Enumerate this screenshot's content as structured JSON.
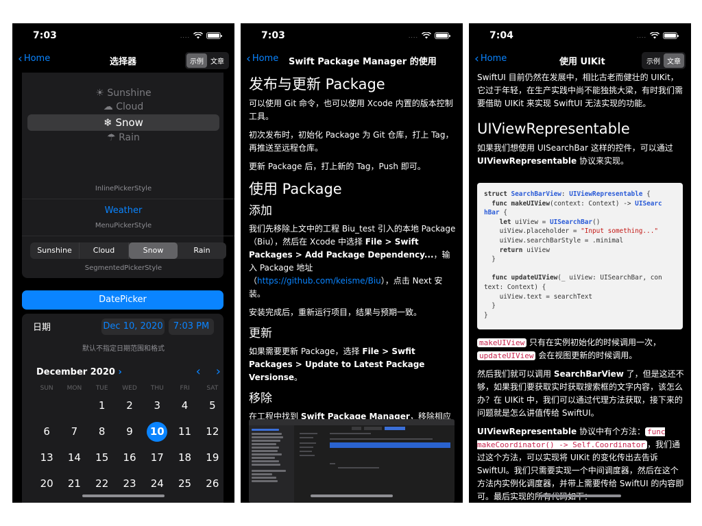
{
  "screens": {
    "picker": {
      "time": "7:03",
      "back_label": "Home",
      "title": "选择器",
      "seg": [
        "示例",
        "文章"
      ],
      "wheel": [
        "Sunshine",
        "Cloud",
        "Snow",
        "Rain"
      ],
      "inline_caption": "InlinePickerStyle",
      "menu_value": "Weather",
      "menu_caption": "MenuPickerStyle",
      "segmented": [
        "Sunshine",
        "Cloud",
        "Snow",
        "Rain"
      ],
      "segmented_selected": "Snow",
      "segmented_caption": "SegmentedPickerStyle",
      "datepicker_button": "DatePicker",
      "date_label": "日期",
      "date_value": "Dec 10, 2020",
      "time_value": "7:03 PM",
      "default_note": "默认不指定日期范围和格式",
      "month": "December 2020",
      "weekdays": [
        "SUN",
        "MON",
        "TUE",
        "WED",
        "THU",
        "FRI",
        "SAT"
      ],
      "days": [
        "",
        "",
        "1",
        "2",
        "3",
        "4",
        "5",
        "6",
        "7",
        "8",
        "9",
        "10",
        "11",
        "12",
        "13",
        "14",
        "15",
        "16",
        "17",
        "18",
        "19",
        "20",
        "21",
        "22",
        "23",
        "24",
        "25",
        "26"
      ],
      "today": "10"
    },
    "spm": {
      "time": "7:03",
      "back_label": "Home",
      "title": "Swift Package Manager 的使用",
      "h_publish": "发布与更新 Package",
      "p1": "可以使用 Git 命令，也可以使用 Xcode 内置的版本控制工具。",
      "p2": "初次发布时，初始化 Package 为 Git 仓库，打上 Tag，再推送至远程仓库。",
      "p3": "更新 Package 后，打上新的 Tag，Push 即可。",
      "h_use": "使用 Package",
      "h_add": "添加",
      "p4_a": "我们先移除上文中的工程 Biu_test 引入的本地 Package（Biu），然后在 Xcode 中选择 ",
      "p4_b": "File > Swift Packages > Add Package Dependency...",
      "p4_c": "，输入 Package 地址（",
      "p4_link": "https://github.com/keisme/Biu",
      "p4_d": "），点击 Next 安装。",
      "p5": "安装完成后，重新运行项目，结果与预期一致。",
      "h_update": "更新",
      "p6_a": "如果需要更新 Package，选择 ",
      "p6_b": "File > Swfit Packages > Update to Latest Package Versionse",
      "p6_c": "。",
      "h_remove": "移除",
      "p7_a": "在工程中找到 ",
      "p7_b": "Swift Package Manager",
      "p7_c": "，移除相应的 Package。"
    },
    "uikit": {
      "time": "7:04",
      "back_label": "Home",
      "title": "使用 UIKit",
      "seg": [
        "示例",
        "文章"
      ],
      "intro": "SwiftUI 目前仍然在发展中，相比古老而健壮的 UIKit，它过于年轻，在生产实践中尚不能独挑大梁，有时我们需要借助 UIKit 来实现 SwiftUI 无法实现的功能。",
      "h_rep": "UIViewRepresentable",
      "p1_a": "如果我们想使用 UISearchBar 这样的控件，可以通过 ",
      "p1_b": "UIViewRepresentable",
      "p1_c": " 协议来实现。",
      "code": [
        {
          "t": "kw",
          "v": "struct "
        },
        {
          "t": "ty",
          "v": "SearchBarView"
        },
        {
          "t": "",
          "v": ": "
        },
        {
          "t": "ty",
          "v": "UIViewRepresentable"
        },
        {
          "t": "",
          "v": " {\n  "
        },
        {
          "t": "kw",
          "v": "func "
        },
        {
          "t": "kw",
          "v": "makeUIView"
        },
        {
          "t": "",
          "v": "(context: Context) -> "
        },
        {
          "t": "ty",
          "v": "UISearc\nhBar"
        },
        {
          "t": "",
          "v": " {\n    "
        },
        {
          "t": "kw",
          "v": "let"
        },
        {
          "t": "",
          "v": " uiView = "
        },
        {
          "t": "ty",
          "v": "UISearchBar"
        },
        {
          "t": "",
          "v": "()\n    uiView.placeholder = "
        },
        {
          "t": "st",
          "v": "\"Input something...\""
        },
        {
          "t": "",
          "v": "\n    uiView.searchBarStyle = .minimal\n    "
        },
        {
          "t": "kw",
          "v": "return"
        },
        {
          "t": "",
          "v": " uiView\n  }\n\n  "
        },
        {
          "t": "kw",
          "v": "func "
        },
        {
          "t": "kw",
          "v": "updateUIView"
        },
        {
          "t": "",
          "v": "(_ uiView: UISearchBar, con\ntext: Context) {\n    uiView.text = searchText\n  }\n}"
        }
      ],
      "c_make": "makeUIView",
      "p2_a": " 只有在实例初始化的时候调用一次，",
      "c_update": "updateUIView",
      "p2_b": " 会在视图更新的时候调用。",
      "p3_a": "然后我们就可以调用 ",
      "p3_b": "SearchBarView",
      "p3_c": " 了，但是这还不够，如果我们要获取实时获取搜索框的文字内容，该怎么办？在 UIKit 中，我们可以通过代理方法获取，接下来的问题就是怎么讲值传给 SwiftUI。",
      "p4_a": "UIViewRepresentable",
      "p4_b": " 协议中有个方法：",
      "c_func": "func makeCoordinator() -> Self.Coordinator",
      "p4_c": "，我们通过这个方法，可以实现将 UIKit 的变化传出去告诉 SwiftUI。我们只需要实现一个中间调度器，然后在这个方法内实例化调度器，并带上需要传给 SwiftUI 的内容即可。最后实现的所有代码如下："
    }
  },
  "colors": {
    "accent": "#0a84ff",
    "background": "#000000",
    "card": "#1c1c1e"
  },
  "icons": {
    "weather": [
      "sun-icon",
      "cloud-icon",
      "snowflake-icon",
      "cloud-rain-icon"
    ]
  }
}
